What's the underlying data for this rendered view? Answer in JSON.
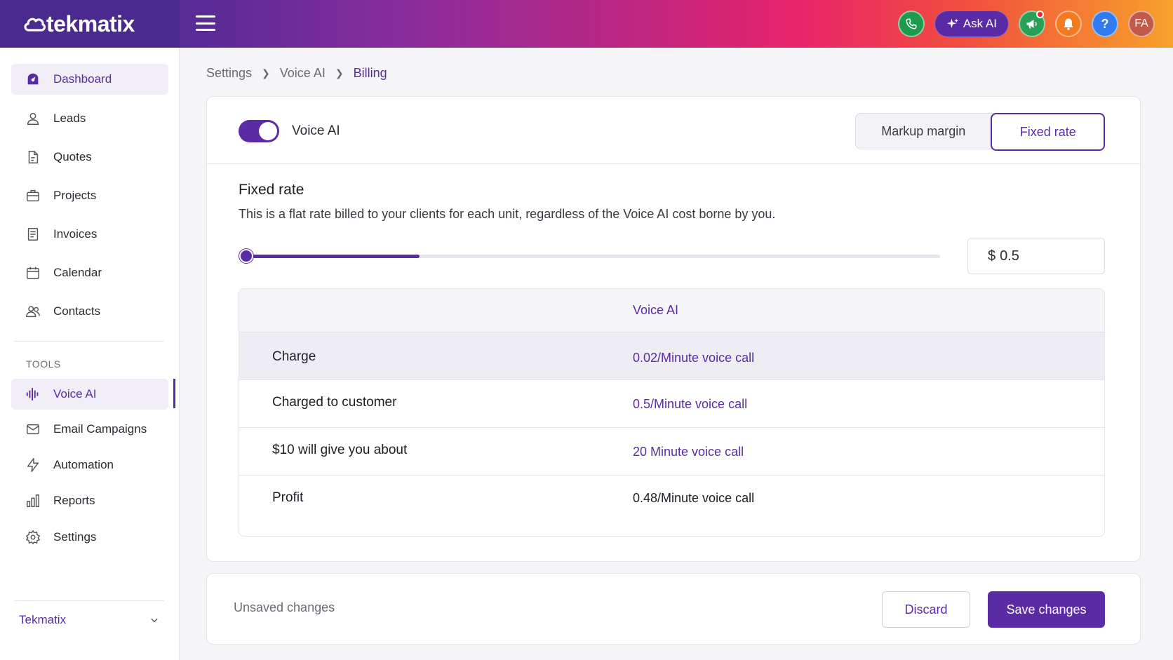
{
  "brand": {
    "name": "tekmatix"
  },
  "topbar": {
    "ask_ai_label": "Ask AI",
    "help_label": "?",
    "avatar_initials": "FA"
  },
  "sidebar": {
    "items": [
      {
        "label": "Dashboard",
        "icon": "dashboard-icon"
      },
      {
        "label": "Leads",
        "icon": "user-icon"
      },
      {
        "label": "Quotes",
        "icon": "document-icon"
      },
      {
        "label": "Projects",
        "icon": "briefcase-icon"
      },
      {
        "label": "Invoices",
        "icon": "invoice-icon"
      },
      {
        "label": "Calendar",
        "icon": "calendar-icon"
      },
      {
        "label": "Contacts",
        "icon": "contacts-icon"
      }
    ],
    "tools_label": "TOOLS",
    "tools": [
      {
        "label": "Voice AI",
        "icon": "soundwave-icon"
      },
      {
        "label": "Email Campaigns",
        "icon": "mail-icon"
      },
      {
        "label": "Automation",
        "icon": "lightning-icon"
      },
      {
        "label": "Reports",
        "icon": "bar-chart-icon"
      },
      {
        "label": "Settings",
        "icon": "gear-icon"
      }
    ],
    "workspace": "Tekmatix"
  },
  "breadcrumb": [
    "Settings",
    "Voice AI",
    "Billing"
  ],
  "card": {
    "toggle_label": "Voice AI",
    "toggle_on": true,
    "mode_options": [
      "Markup margin",
      "Fixed rate"
    ],
    "selected_mode": "Fixed rate",
    "section_title": "Fixed rate",
    "section_desc": "This is a flat rate billed to your clients for each unit, regardless of the Voice AI cost borne by you.",
    "slider_fraction": 0.25,
    "rate_prefix": "$",
    "rate_value": "0.5",
    "table": {
      "column": "Voice AI",
      "rows": [
        {
          "label": "Charge",
          "value": "0.02/Minute voice call"
        },
        {
          "label": "Charged to customer",
          "value": "0.5/Minute voice call"
        },
        {
          "label": "$10 will give you about",
          "value": "20 Minute voice call"
        },
        {
          "label": "Profit",
          "value": "0.48/Minute voice call"
        }
      ]
    }
  },
  "footer": {
    "status": "Unsaved changes",
    "discard_label": "Discard",
    "save_label": "Save changes"
  },
  "colors": {
    "accent": "#5b2ba6"
  }
}
